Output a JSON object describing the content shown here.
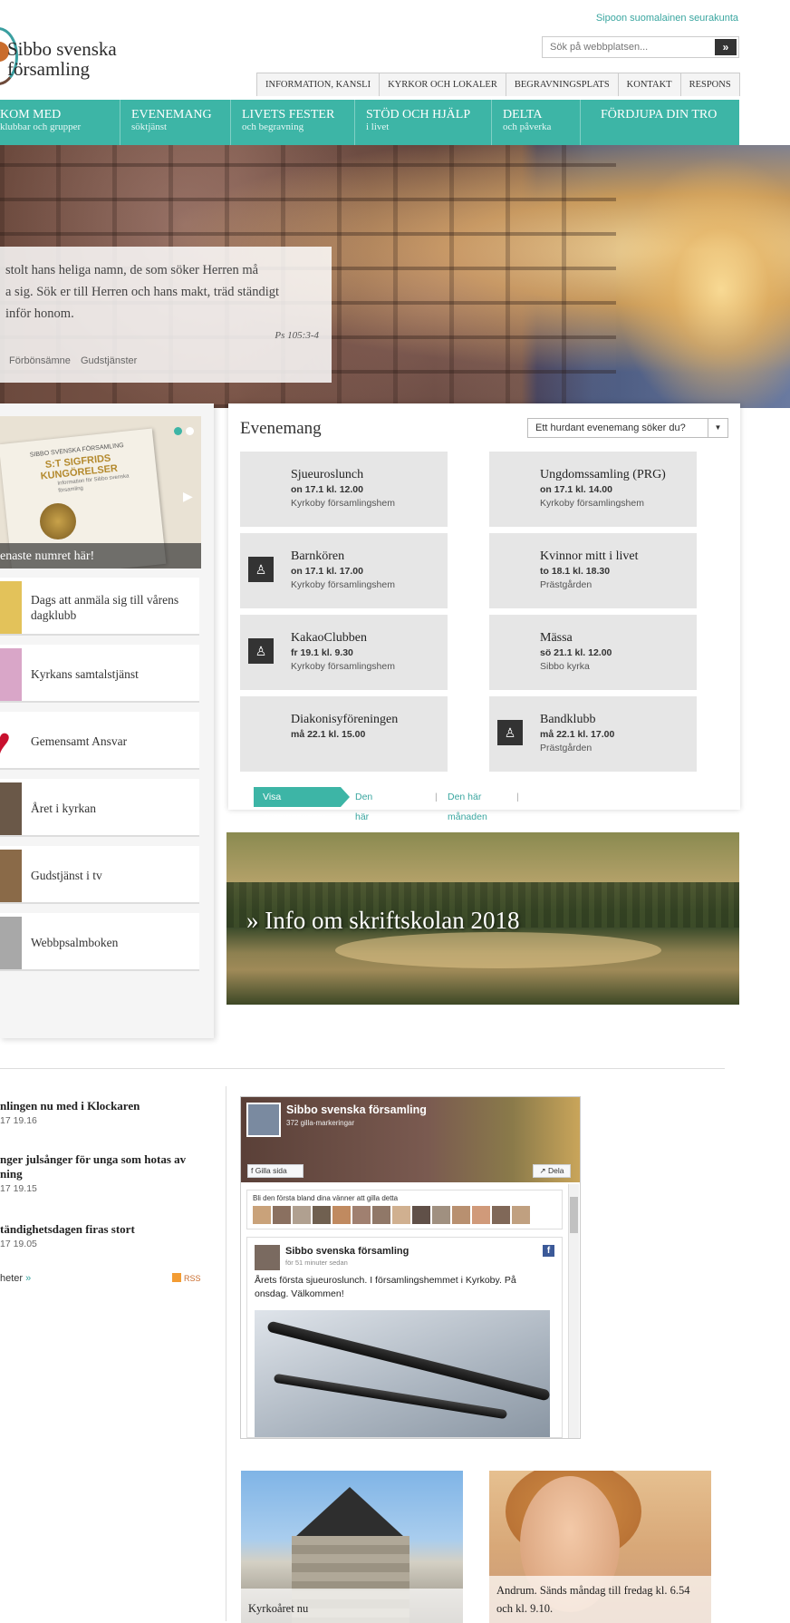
{
  "header": {
    "lang_link": "Sipoon suomalainen seurakunta",
    "logo_line1": "Sibbo svenska",
    "logo_line2": "församling",
    "search_placeholder": "Sök på webbplatsen...",
    "search_button": "»",
    "util_nav": [
      "INFORMATION, KANSLI",
      "KYRKOR OCH LOKALER",
      "BEGRAVNINGSPLATS",
      "KONTAKT",
      "RESPONS"
    ]
  },
  "nav": [
    {
      "title": "KOM MED",
      "sub": "klubbar och grupper"
    },
    {
      "title": "EVENEMANG",
      "sub": "söktjänst"
    },
    {
      "title": "LIVETS FESTER",
      "sub": "och begravning"
    },
    {
      "title": "STÖD OCH HJÄLP",
      "sub": "i livet"
    },
    {
      "title": "DELTA",
      "sub": "och påverka"
    },
    {
      "title": "FÖRDJUPA DIN TRO",
      "sub": ""
    }
  ],
  "hero": {
    "quote_line1": "stolt hans heliga namn, de som söker Herren må",
    "quote_line2": "a sig. Sök er till Herren och hans makt, träd ständigt",
    "quote_line3": "inför honom.",
    "reference": "Ps 105:3-4",
    "tag1": "Förbönsämne",
    "tag2": "Gudstjänster"
  },
  "left": {
    "promo": {
      "paper_small": "SIBBO SVENSKA FÖRSAMLING",
      "paper_title": "S:T SIGFRIDS KUNGÖRELSER",
      "paper_body": "Information för Sibbo svenska församling",
      "caption": "enaste numret här!"
    },
    "items": [
      {
        "label": "Dags att anmäla sig till vårens dagklubb",
        "thumb": "#e3c25a"
      },
      {
        "label": "Kyrkans samtalstjänst",
        "thumb": "#d9a6c8"
      },
      {
        "label": "Gemensamt Ansvar",
        "thumb": "#c8102e"
      },
      {
        "label": "Året i kyrkan",
        "thumb": "#6a5848"
      },
      {
        "label": "Gudstjänst i tv",
        "thumb": "#8a6a48"
      },
      {
        "label": "Webbpsalmboken",
        "thumb": "#a8a8a8"
      }
    ]
  },
  "events": {
    "heading": "Evenemang",
    "filter": "Ett hurdant evenemang söker du?",
    "list": [
      {
        "name": "Sjueuroslunch",
        "date": "on 17.1 kl. 12.00",
        "place": "Kyrkoby församlingshem",
        "icon": ""
      },
      {
        "name": "Ungdomssamling (PRG)",
        "date": "on 17.1 kl. 14.00",
        "place": "Kyrkoby församlingshem",
        "icon": ""
      },
      {
        "name": "Barnkören",
        "date": "on 17.1 kl. 17.00",
        "place": "Kyrkoby församlingshem",
        "icon": "child-icon"
      },
      {
        "name": "Kvinnor mitt i livet",
        "date": "to 18.1 kl. 18.30",
        "place": "Prästgården",
        "icon": ""
      },
      {
        "name": "KakaoClubben",
        "date": "fr 19.1 kl. 9.30",
        "place": "Kyrkoby församlingshem",
        "icon": "child-icon"
      },
      {
        "name": "Mässa",
        "date": "sö 21.1 kl. 12.00",
        "place": "Sibbo kyrka",
        "icon": ""
      },
      {
        "name": "Diakonisyföreningen",
        "date": "må 22.1 kl. 15.00",
        "place": "",
        "icon": ""
      },
      {
        "name": "Bandklubb",
        "date": "må 22.1 kl. 17.00",
        "place": "Prästgården",
        "icon": "child-icon"
      }
    ],
    "show_label": "Visa evenemangen:",
    "week_link": "Den här veckan",
    "month_link": "Den här månaden",
    "separator": "|"
  },
  "banner": {
    "text": "» Info om skriftskolan 2018"
  },
  "news": {
    "items": [
      {
        "title_lines": [
          "nlingen nu med i Klockaren"
        ],
        "date": "17 19.16"
      },
      {
        "title_lines": [
          "nger julsånger för unga som hotas av",
          "ning"
        ],
        "date": "17 19.15"
      },
      {
        "title_lines": [
          "tändighetsdagen firas stort"
        ],
        "date": "17 19.05"
      }
    ],
    "more": "heter",
    "more_arrow": "»",
    "rss": "RSS"
  },
  "facebook": {
    "page_name": "Sibbo svenska församling",
    "likes": "372 gilla-markeringar",
    "like_button": "Gilla sida",
    "share_button": "Dela",
    "friends_text": "Bli den första bland dina vänner att gilla detta",
    "post_author": "Sibbo svenska församling",
    "post_time": "för 51 minuter sedan",
    "post_text": "Årets första sjueuroslunch. I församlingshemmet i Kyrkoby. På onsdag. Välkommen!"
  },
  "tiles": [
    {
      "caption": "Kyrkoåret nu"
    },
    {
      "caption": "Andrum. Sänds måndag till fredag kl. 6.54 och kl. 9.10."
    }
  ]
}
